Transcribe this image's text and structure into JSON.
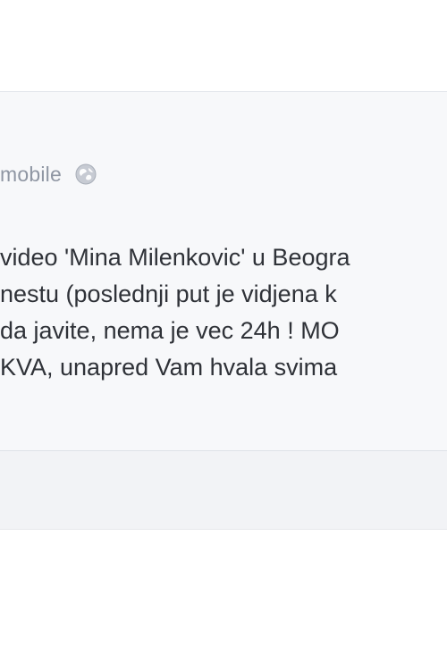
{
  "post": {
    "meta_text": "mobile",
    "globe_icon": "globe-icon",
    "lines": [
      "video 'Mina Milenkovic' u Beogra",
      "nestu (poslednji put je vidjena k",
      "da javite, nema je vec 24h ! MO",
      "KVA, unapred Vam hvala svima"
    ]
  },
  "colors": {
    "card_bg": "#f7f8fa",
    "meta_text": "#8f96a3",
    "post_text": "#2f3238"
  }
}
